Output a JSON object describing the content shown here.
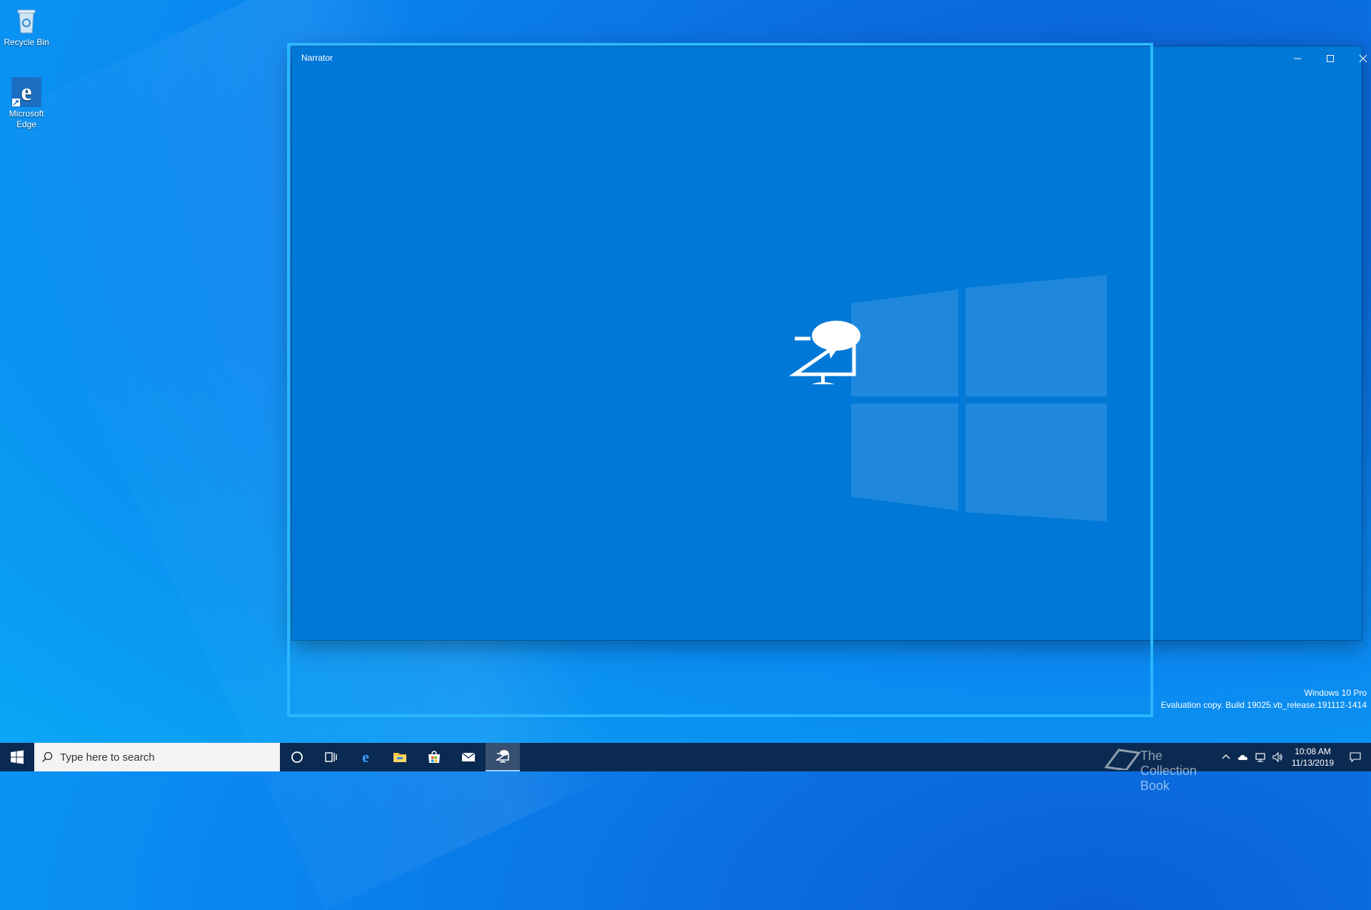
{
  "desktop": {
    "icons": [
      {
        "label": "Recycle Bin"
      },
      {
        "label": "Microsoft Edge"
      }
    ]
  },
  "window": {
    "title": "Narrator",
    "controls": {
      "minimize": "minimize",
      "maximize": "maximize",
      "close": "close"
    }
  },
  "watermark": {
    "edition": "Windows 10 Pro",
    "build": "Evaluation copy. Build 19025.vb_release.191112-1414",
    "brand": "The Collection Book"
  },
  "taskbar": {
    "search_placeholder": "Type here to search",
    "apps": [
      "cortana",
      "task-view",
      "edge",
      "file-explorer",
      "store",
      "mail",
      "narrator"
    ],
    "active_app": "narrator"
  },
  "tray": {
    "time": "10:08 AM",
    "date": "11/13/2019"
  },
  "colors": {
    "window_bg": "#0078d7",
    "focus_rect": "#29b7ff",
    "taskbar_bg": "#0b2a52"
  }
}
